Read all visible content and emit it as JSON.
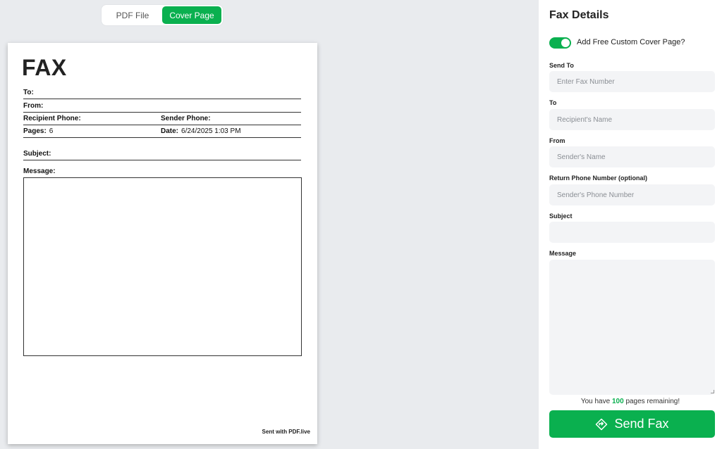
{
  "tabs": {
    "pdf_file": "PDF File",
    "cover_page": "Cover Page"
  },
  "sheet": {
    "title": "FAX",
    "to_label": "To:",
    "from_label": "From:",
    "recipient_phone_label": "Recipient Phone:",
    "sender_phone_label": "Sender Phone:",
    "pages_label": "Pages:",
    "pages_value": "6",
    "date_label": "Date:",
    "date_value": "6/24/2025 1:03 PM",
    "subject_label": "Subject:",
    "message_label": "Message:",
    "footer": "Sent with PDF.live"
  },
  "panel": {
    "title": "Fax Details",
    "toggle_label": "Add Free Custom Cover Page?",
    "toggle_on": true,
    "send_to_label": "Send To",
    "send_to_placeholder": "Enter Fax Number",
    "to_label": "To",
    "to_placeholder": "Recipient's Name",
    "from_label": "From",
    "from_placeholder": "Sender's Name",
    "return_label": "Return Phone Number (optional)",
    "return_placeholder": "Sender's Phone Number",
    "subject_label": "Subject",
    "subject_placeholder": "",
    "message_label": "Message",
    "remaining_prefix": "You have",
    "remaining_count": "100",
    "remaining_suffix": "pages remaining!",
    "send_label": "Send Fax",
    "send_icon": "diamond-arrow-icon"
  },
  "colors": {
    "accent": "#0ab04f",
    "background": "#e9ebee",
    "field_bg": "#f3f4f6"
  }
}
